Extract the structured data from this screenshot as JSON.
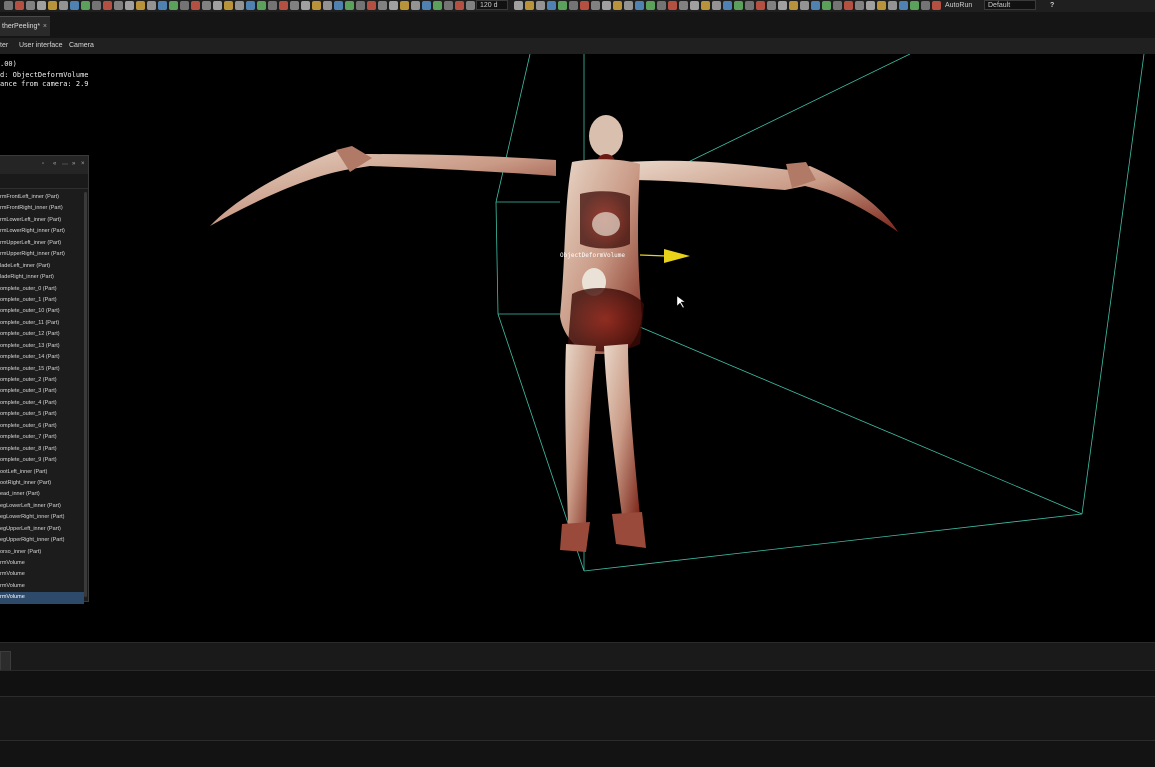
{
  "toolbar": {
    "zoom_value": "120 d",
    "autorun_label": "AutoRun",
    "preset_value": "Default",
    "help_label": "?"
  },
  "tabs": {
    "active_tab_label": "therPeeling",
    "active_tab_modified": "*",
    "close_glyph": "×"
  },
  "menu": {
    "items": [
      "ter",
      "User interface",
      "Camera"
    ]
  },
  "overlay": {
    "lines": [
      ".00)",
      "d: ObjectDeformVolume",
      "ance from camera: 2.9"
    ],
    "gizmo_label": "ObjectDeformVolume"
  },
  "outliner": {
    "items": [
      "rmFrontLeft_inner (Part)",
      "rmFrontRight_inner (Part)",
      "rmLowerLeft_inner (Part)",
      "rmLowerRight_inner (Part)",
      "rmUpperLeft_inner (Part)",
      "rmUpperRight_inner (Part)",
      "ladeLeft_inner (Part)",
      "ladeRight_inner (Part)",
      "omplete_outer_0 (Part)",
      "omplete_outer_1 (Part)",
      "omplete_outer_10 (Part)",
      "omplete_outer_11 (Part)",
      "omplete_outer_12 (Part)",
      "omplete_outer_13 (Part)",
      "omplete_outer_14 (Part)",
      "omplete_outer_15 (Part)",
      "omplete_outer_2 (Part)",
      "omplete_outer_3 (Part)",
      "omplete_outer_4 (Part)",
      "omplete_outer_5 (Part)",
      "omplete_outer_6 (Part)",
      "omplete_outer_7 (Part)",
      "omplete_outer_8 (Part)",
      "omplete_outer_9 (Part)",
      "ootLeft_inner (Part)",
      "ootRight_inner (Part)",
      "ead_inner (Part)",
      "egLowerLeft_inner (Part)",
      "egLowerRight_inner (Part)",
      "egUpperLeft_inner (Part)",
      "egUpperRight_inner (Part)",
      "orso_inner (Part)",
      "rmVolume",
      "rmVolume",
      "rmVolume",
      "rmVolume"
    ],
    "selected_index": 35
  },
  "colors": {
    "bounding_box": "#3fbfa6",
    "gizmo_arrow": "#e8d21a",
    "selection": "#2d4a6a"
  }
}
